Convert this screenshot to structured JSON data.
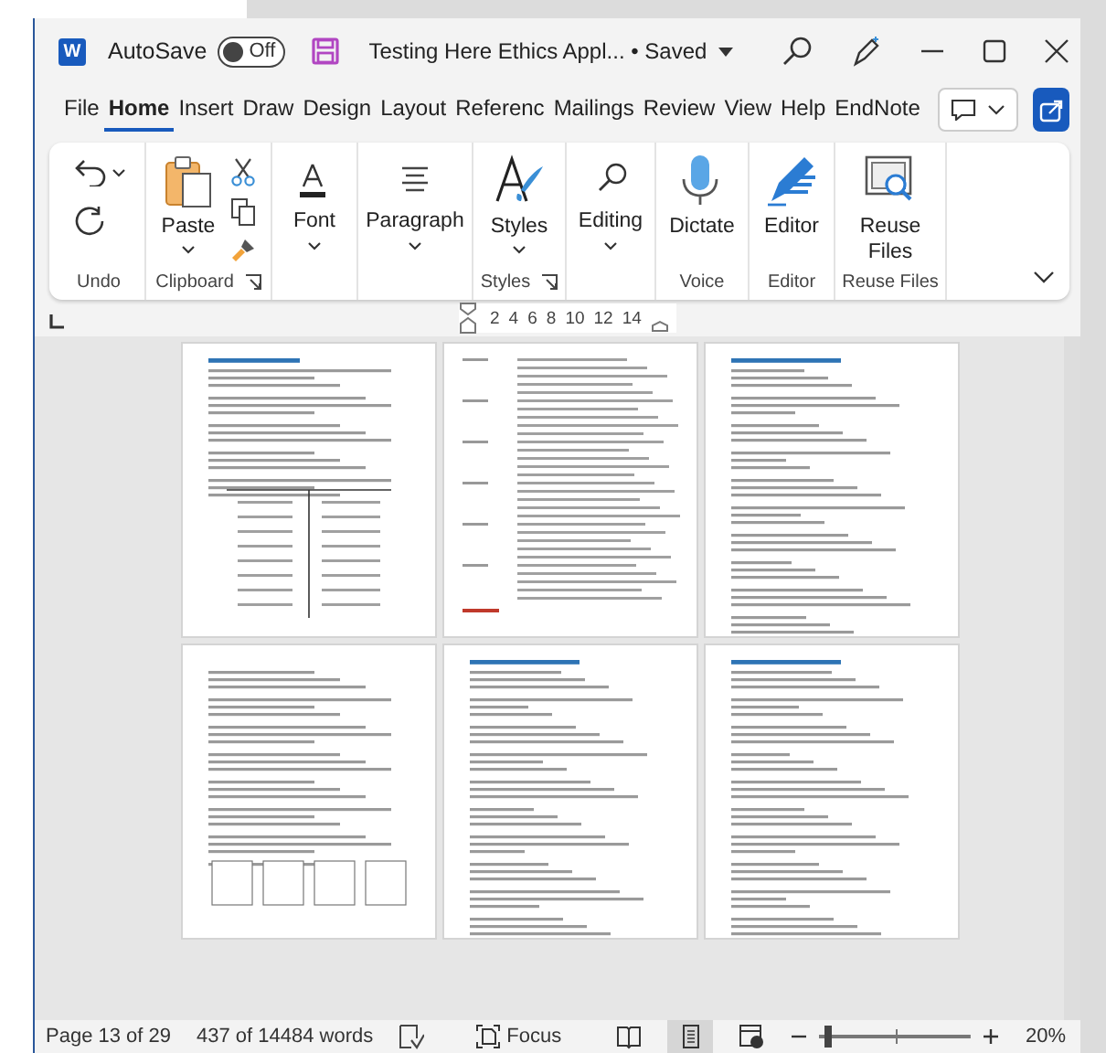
{
  "title_bar": {
    "app": "W",
    "autosave_label": "AutoSave",
    "autosave_on": false,
    "autosave_state": "Off",
    "document_title": "Testing Here Ethics Appl... • Saved"
  },
  "tabs": [
    {
      "label": "File",
      "selected": false
    },
    {
      "label": "Home",
      "selected": true
    },
    {
      "label": "Insert",
      "selected": false
    },
    {
      "label": "Draw",
      "selected": false
    },
    {
      "label": "Design",
      "selected": false
    },
    {
      "label": "Layout",
      "selected": false
    },
    {
      "label": "Referenc",
      "selected": false
    },
    {
      "label": "Mailings",
      "selected": false
    },
    {
      "label": "Review",
      "selected": false
    },
    {
      "label": "View",
      "selected": false
    },
    {
      "label": "Help",
      "selected": false
    },
    {
      "label": "EndNote",
      "selected": false
    }
  ],
  "ribbon_groups": [
    {
      "kind": "undo",
      "name": "Undo"
    },
    {
      "kind": "clipboard",
      "name": "Clipboard",
      "launcher": true,
      "button": "Paste"
    },
    {
      "kind": "font",
      "button": "Font"
    },
    {
      "kind": "paragraph",
      "button": "Paragraph"
    },
    {
      "kind": "styles",
      "name": "Styles",
      "button": "Styles",
      "launcher": true
    },
    {
      "kind": "editing",
      "button": "Editing"
    },
    {
      "kind": "voice",
      "name": "Voice",
      "button": "Dictate"
    },
    {
      "kind": "editor",
      "name": "Editor",
      "button": "Editor"
    },
    {
      "kind": "reuse",
      "name": "Reuse Files",
      "button": "Reuse\nFiles"
    }
  ],
  "ruler": {
    "ticks": [
      "2",
      "4",
      "6",
      "8",
      "10",
      "12",
      "14"
    ]
  },
  "pages": [
    {
      "kind": "table"
    },
    {
      "kind": "definitions"
    },
    {
      "kind": "text"
    },
    {
      "kind": "diagram"
    },
    {
      "kind": "text"
    },
    {
      "kind": "text"
    }
  ],
  "status_bar": {
    "page": "Page 13 of 29",
    "words": "437 of 14484 words",
    "focus": "Focus",
    "views": [
      {
        "kind": "read",
        "selected": false
      },
      {
        "kind": "print",
        "selected": true
      },
      {
        "kind": "web",
        "selected": false
      }
    ],
    "zoom": {
      "level": 0.03,
      "reading": "20%"
    }
  }
}
